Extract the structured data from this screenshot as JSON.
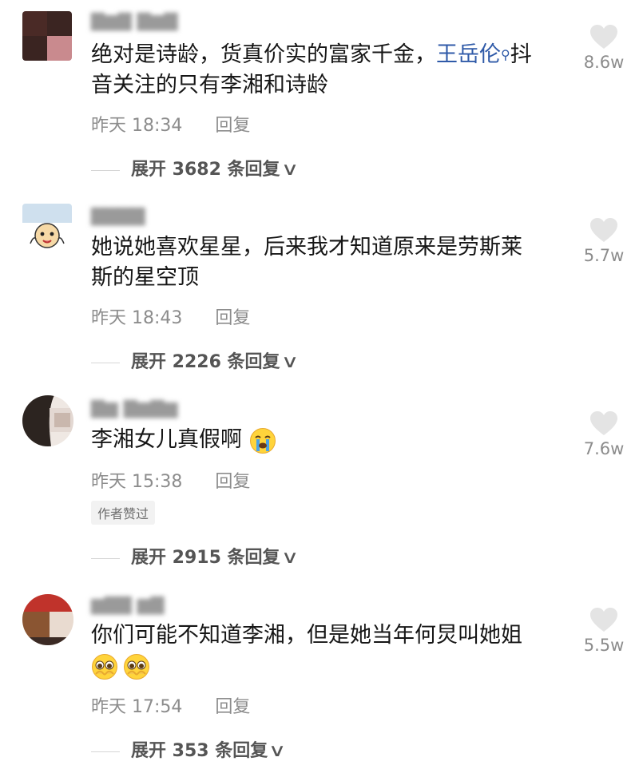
{
  "comments": [
    {
      "text_main": "绝对是诗龄，货真价实的富家千金，",
      "mention": "王岳伦",
      "text_after_mention": "抖",
      "text_line2": "音关注的只有李湘和诗龄",
      "time": "昨天 18:34",
      "reply": "回复",
      "expand": "展开 3682 条回复",
      "likes": "8.6w"
    },
    {
      "text_line1": "她说她喜欢星星，后来我才知道原来是劳斯莱",
      "text_line2": "斯的星空顶",
      "time": "昨天 18:43",
      "reply": "回复",
      "expand": "展开 2226 条回复",
      "likes": "5.7w"
    },
    {
      "text_line1": "李湘女儿真假啊",
      "time": "昨天 15:38",
      "reply": "回复",
      "badge": "作者赞过",
      "expand": "展开 2915 条回复",
      "likes": "7.6w"
    },
    {
      "text_line1": "你们可能不知道李湘，但是她当年何炅叫她姐",
      "time": "昨天 17:54",
      "reply": "回复",
      "expand": "展开 353 条回复",
      "likes": "5.5w"
    }
  ],
  "icons": {
    "like": "heart-icon",
    "expand_chevron": "chevron-down-icon",
    "mention_search": "search-icon",
    "emoji_cry": "crying-face-emoji",
    "emoji_pleading": "pleading-face-emoji"
  },
  "colors": {
    "mention": "#2f5aa8",
    "meta": "#8c8c8c",
    "heart": "#e4e4e4"
  }
}
